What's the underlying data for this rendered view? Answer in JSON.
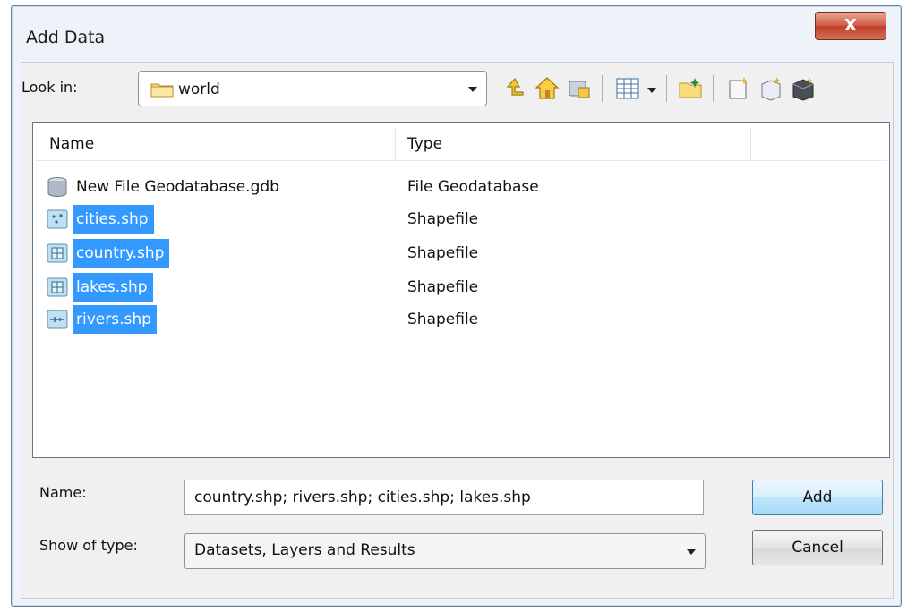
{
  "window": {
    "title": "Add Data",
    "close_glyph": "X"
  },
  "look_in": {
    "label": "Look in:",
    "value": "world",
    "icon": "folder-icon"
  },
  "toolbar": {
    "buttons": [
      "up-one-level-icon",
      "home-icon",
      "connect-icon",
      "views-icon",
      "views-dropdown-icon",
      "new-folder-icon",
      "new-file-icon",
      "new-shapefile-icon",
      "new-database-icon"
    ]
  },
  "file_list": {
    "columns": [
      "Name",
      "Type"
    ],
    "rows": [
      {
        "name": "New File Geodatabase.gdb",
        "type": "File Geodatabase",
        "icon": "geodatabase-icon",
        "selected": false
      },
      {
        "name": "cities.shp",
        "type": "Shapefile",
        "icon": "point-shapefile-icon",
        "selected": true
      },
      {
        "name": "country.shp",
        "type": "Shapefile",
        "icon": "polygon-shapefile-icon",
        "selected": true
      },
      {
        "name": "lakes.shp",
        "type": "Shapefile",
        "icon": "polygon-shapefile-icon",
        "selected": true
      },
      {
        "name": "rivers.shp",
        "type": "Shapefile",
        "icon": "line-shapefile-icon",
        "selected": true
      }
    ]
  },
  "name_field": {
    "label": "Name:",
    "value": "country.shp; rivers.shp; cities.shp; lakes.shp"
  },
  "type_field": {
    "label": "Show of type:",
    "value": "Datasets, Layers and Results"
  },
  "buttons": {
    "add": "Add",
    "cancel": "Cancel"
  },
  "colors": {
    "selection": "#3399ff",
    "default_button": "#bee6fd",
    "close_button": "#c94a33"
  }
}
